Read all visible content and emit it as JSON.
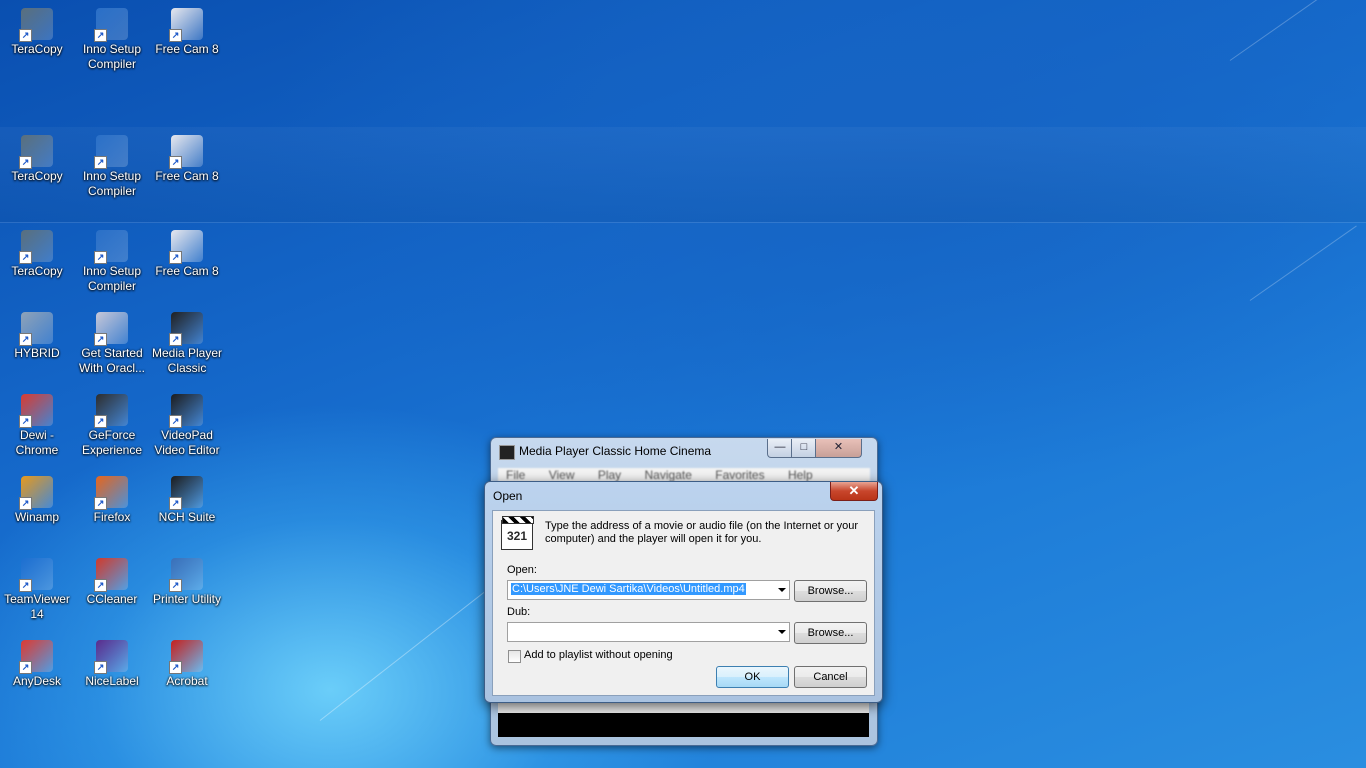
{
  "desktop": {
    "icons": [
      {
        "label": "TeraCopy",
        "icon": "teracopy-icon",
        "color": "#5a6f7c"
      },
      {
        "label": "Inno Setup\nCompiler",
        "icon": "inno-setup-icon",
        "color": "#2a70c8"
      },
      {
        "label": "Free Cam 8",
        "icon": "free-cam-icon",
        "color": "#e8e8ee"
      },
      {
        "label": "TeraCopy",
        "icon": "teracopy-icon",
        "color": "#5a6f7c"
      },
      {
        "label": "Inno Setup\nCompiler",
        "icon": "inno-setup-icon",
        "color": "#2a70c8"
      },
      {
        "label": "Free Cam 8",
        "icon": "free-cam-icon",
        "color": "#e8e8ee"
      },
      {
        "label": "TeraCopy",
        "icon": "teracopy-icon",
        "color": "#5a6f7c"
      },
      {
        "label": "Inno Setup\nCompiler",
        "icon": "inno-setup-icon",
        "color": "#2a70c8"
      },
      {
        "label": "Free Cam 8",
        "icon": "free-cam-icon",
        "color": "#e8e8ee"
      },
      {
        "label": "HYBRID",
        "icon": "hybrid-icon",
        "color": "#8fa3b8"
      },
      {
        "label": "Get Started\nWith Oracl...",
        "icon": "oracle-icon",
        "color": "#c8c8d8"
      },
      {
        "label": "Media Player\nClassic",
        "icon": "media-player-classic-icon",
        "color": "#202020"
      },
      {
        "label": "Dewi -\nChrome",
        "icon": "chrome-icon",
        "color": "#d93b30"
      },
      {
        "label": "GeForce\nExperience",
        "icon": "geforce-icon",
        "color": "#2d2d2d"
      },
      {
        "label": "VideoPad\nVideo Editor",
        "icon": "videopad-icon",
        "color": "#1c1c1c"
      },
      {
        "label": "Winamp",
        "icon": "winamp-icon",
        "color": "#e89a1c"
      },
      {
        "label": "Firefox",
        "icon": "firefox-icon",
        "color": "#e8661c"
      },
      {
        "label": "NCH Suite",
        "icon": "nch-suite-icon",
        "color": "#1c1c1c"
      },
      {
        "label": "TeamViewer\n14",
        "icon": "teamviewer-icon",
        "color": "#1c6fd1"
      },
      {
        "label": "CCleaner",
        "icon": "ccleaner-icon",
        "color": "#d33a2a"
      },
      {
        "label": "Printer Utility",
        "icon": "printer-utility-icon",
        "color": "#3a6fb8"
      },
      {
        "label": "AnyDesk",
        "icon": "anydesk-icon",
        "color": "#e03a30"
      },
      {
        "label": "NiceLabel",
        "icon": "nicelabel-icon",
        "color": "#5b2b8c"
      },
      {
        "label": "Acrobat",
        "icon": "acrobat-icon",
        "color": "#c8201c"
      }
    ]
  },
  "mpc_window": {
    "title": "Media Player Classic Home Cinema",
    "minimize": "—",
    "maximize": "□",
    "close": "✕",
    "menu": [
      "File",
      "View",
      "Play",
      "Navigate",
      "Favorites",
      "Help"
    ]
  },
  "open_dialog": {
    "title": "Open",
    "close": "✕",
    "logo_text": "321",
    "info": "Type the address of a movie or audio file (on the Internet or your computer) and the player will open it for you.",
    "open_label": "Open:",
    "open_value": "C:\\Users\\JNE Dewi Sartika\\Videos\\Untitled.mp4",
    "browse_label": "Browse...",
    "dub_label": "Dub:",
    "dub_value": "",
    "browse2_label": "Browse...",
    "add_playlist_label": "Add to playlist without opening",
    "add_playlist_checked": false,
    "ok_label": "OK",
    "cancel_label": "Cancel"
  }
}
